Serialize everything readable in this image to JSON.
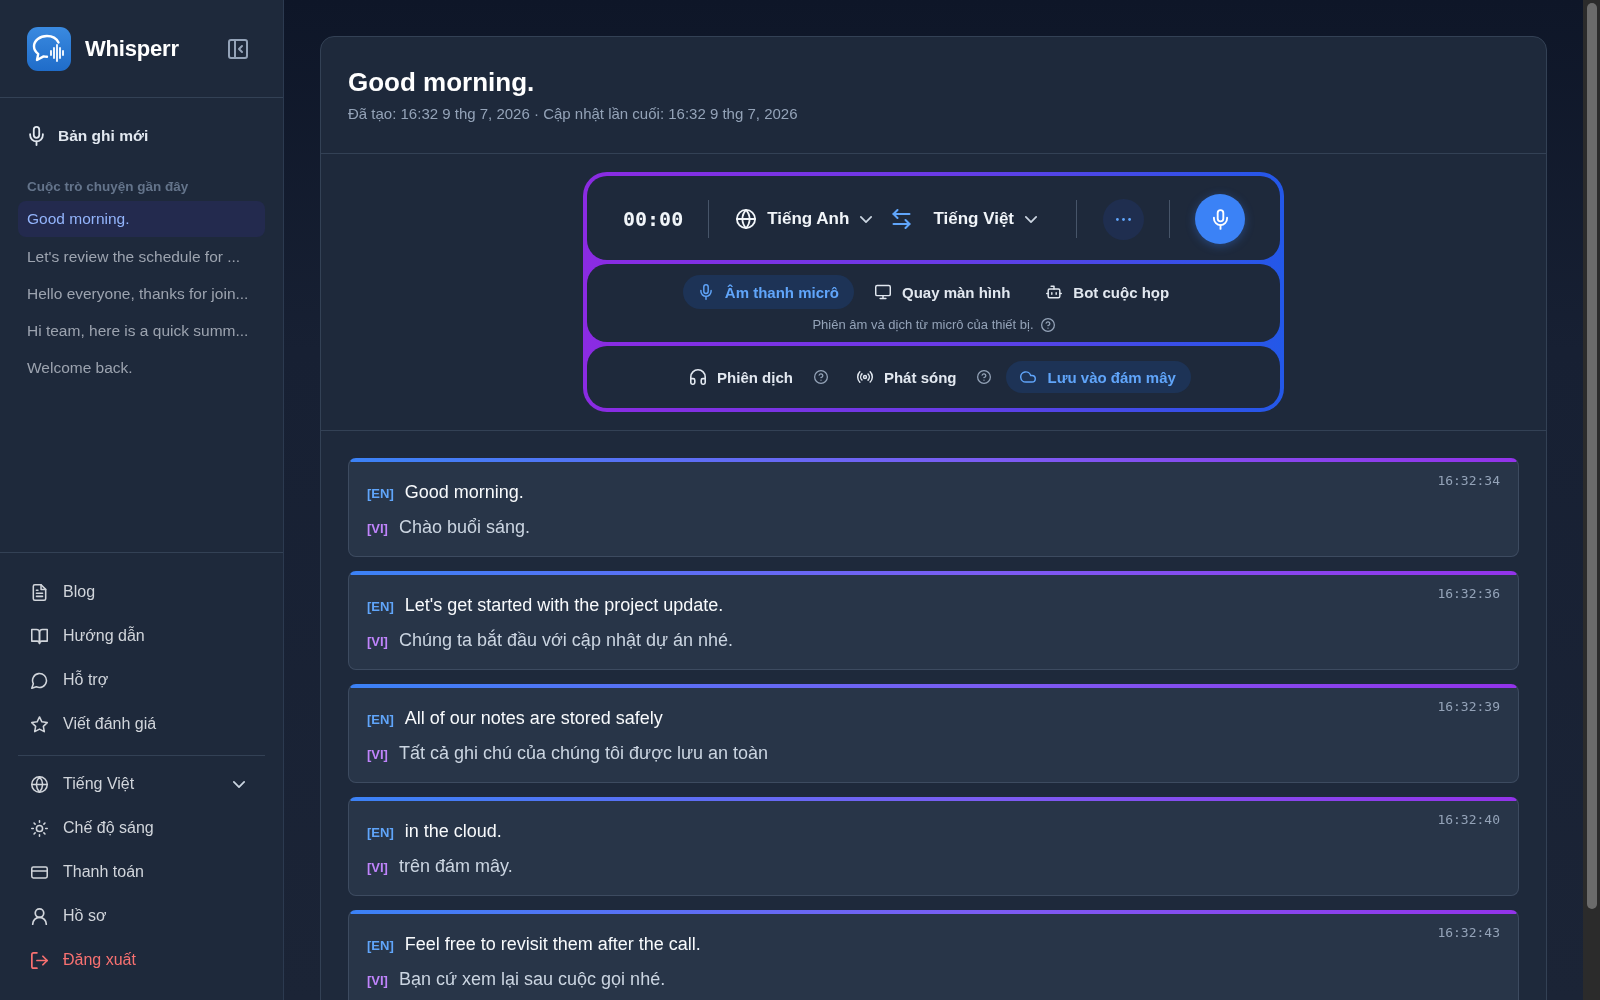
{
  "sidebar": {
    "brand": {
      "name": "Whisperr"
    },
    "new_recording": {
      "label": "Bản ghi mới"
    },
    "recent": {
      "heading": "Cuộc trò chuyện gần đây",
      "items": [
        {
          "label": "Good morning.",
          "selected": true
        },
        {
          "label": "Let's review the schedule for ...",
          "selected": false
        },
        {
          "label": "Hello everyone, thanks for join...",
          "selected": false
        },
        {
          "label": "Hi team, here is a quick summ...",
          "selected": false
        },
        {
          "label": "Welcome back.",
          "selected": false
        }
      ]
    },
    "links": [
      {
        "kind": "document",
        "label": "Blog"
      },
      {
        "kind": "book",
        "label": "Hướng dẫn"
      },
      {
        "kind": "chat",
        "label": "Hỗ trợ"
      },
      {
        "kind": "star",
        "label": "Viết đánh giá"
      }
    ],
    "settings": [
      {
        "kind": "language",
        "label": "Tiếng Việt"
      },
      {
        "kind": "theme",
        "label": "Chế độ sáng"
      },
      {
        "kind": "billing",
        "label": "Thanh toán"
      },
      {
        "kind": "profile",
        "label": "Hồ sơ"
      },
      {
        "kind": "logout",
        "label": "Đăng xuất"
      }
    ]
  },
  "conversation": {
    "title": "Good morning.",
    "meta": "Đã tạo: 16:32 9 thg 7, 2026 · Cập nhật lần cuối: 16:32 9 thg 7, 2026"
  },
  "recorder": {
    "timer": "00:00",
    "source_language": "Tiếng Anh",
    "target_language": "Tiếng Việt",
    "input_modes": [
      {
        "kind": "mic",
        "label": "Âm thanh micrô",
        "selected": true
      },
      {
        "kind": "screen",
        "label": "Quay màn hình",
        "selected": false
      },
      {
        "kind": "bot",
        "label": "Bot cuộc họp",
        "selected": false
      }
    ],
    "mode_hint": "Phiên âm và dịch từ micrô của thiết bị.",
    "options": [
      {
        "kind": "interpret",
        "label": "Phiên dịch",
        "on": false,
        "help": true
      },
      {
        "kind": "broadcast",
        "label": "Phát sóng",
        "on": false,
        "help": true
      },
      {
        "kind": "cloud",
        "label": "Lưu vào đám mây",
        "on": true,
        "help": false
      }
    ]
  },
  "transcript": [
    {
      "time": "16:32:34",
      "source_tag": "[EN]",
      "source": "Good morning.",
      "target_tag": "[VI]",
      "target": "Chào buổi sáng."
    },
    {
      "time": "16:32:36",
      "source_tag": "[EN]",
      "source": "Let's get started with the project update.",
      "target_tag": "[VI]",
      "target": "Chúng ta bắt đầu với cập nhật dự án nhé."
    },
    {
      "time": "16:32:39",
      "source_tag": "[EN]",
      "source": "All of our notes are stored safely",
      "target_tag": "[VI]",
      "target": "Tất cả ghi chú của chúng tôi được lưu an toàn"
    },
    {
      "time": "16:32:40",
      "source_tag": "[EN]",
      "source": "in the cloud.",
      "target_tag": "[VI]",
      "target": "trên đám mây."
    },
    {
      "time": "16:32:43",
      "source_tag": "[EN]",
      "source": "Feel free to revisit them after the call.",
      "target_tag": "[VI]",
      "target": "Bạn cứ xem lại sau cuộc gọi nhé."
    }
  ]
}
